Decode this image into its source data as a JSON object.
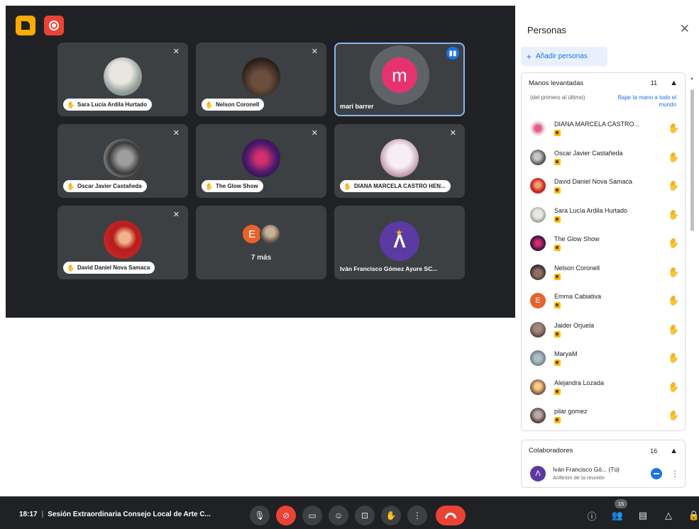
{
  "top_badges": {
    "notes_icon": "notes-icon",
    "record_icon": "recording-icon"
  },
  "tiles": [
    {
      "name": "Sara Lucía Ardila Hurtado",
      "status": "muted",
      "avatar_style": "av1"
    },
    {
      "name": "Nelson Coronell",
      "status": "muted",
      "avatar_style": "av2"
    },
    {
      "name": "mari barrer",
      "status": "speaking",
      "initial": "m"
    },
    {
      "name": "Oscar Javier Castañeda",
      "status": "muted",
      "avatar_style": "av3"
    },
    {
      "name": "The Glow Show",
      "status": "muted",
      "avatar_style": "av4"
    },
    {
      "name": "DIANA MARCELA CASTRO HEN...",
      "status": "muted",
      "avatar_style": "av5"
    },
    {
      "name": "David Daniel Nova Samaca",
      "status": "muted",
      "avatar_style": "av6"
    },
    {
      "more_initial": "E",
      "more_label": "7 más"
    },
    {
      "name": "Iván Francisco Gómez Ayure SC..."
    }
  ],
  "panel": {
    "title": "Personas",
    "add_people": "Añadir personas",
    "raised_hands": {
      "title": "Manos levantadas",
      "count": "11",
      "order_note": "(del primero al último)",
      "lower_all": "Bajar la mano a todo el mundo",
      "people": [
        {
          "name": "DIANA MARCELA CASTRO..."
        },
        {
          "name": "Oscar Javier Castañeda"
        },
        {
          "name": "David Daniel Nova Samaca"
        },
        {
          "name": "Sara Lucía Ardila Hurtado"
        },
        {
          "name": "The Glow Show"
        },
        {
          "name": "Nelson Coronell"
        },
        {
          "name": "Emma Cabiativa",
          "initial": "E"
        },
        {
          "name": "Jaider Orjuela"
        },
        {
          "name": "MaryaM"
        },
        {
          "name": "Alejandra Lozada"
        },
        {
          "name": "pilar gomez"
        }
      ]
    },
    "collaborators": {
      "title": "Colaboradores",
      "count": "16",
      "first": {
        "name": "Iván Francisco Gó... (Tú)",
        "role": "Anfitrión de la reunión"
      }
    }
  },
  "bottom_bar": {
    "time": "18:17",
    "separator": "|",
    "meeting_title": "Sesión Extraordinaria Consejo Local de Arte C...",
    "people_count": "15",
    "controls": [
      "mic-icon",
      "camera-off-icon",
      "captions-icon",
      "emoji-icon",
      "present-icon",
      "raise-hand-icon",
      "more-options-icon",
      "end-call-icon"
    ],
    "right_controls": [
      "info-icon",
      "people-icon",
      "chat-icon",
      "activities-icon",
      "host-controls-icon"
    ]
  },
  "colors": {
    "stage": "#202124",
    "tile": "#3c4043",
    "accent": "#1a73e8",
    "end_call": "#ea4335",
    "hand_badge": "#fbbc04"
  }
}
